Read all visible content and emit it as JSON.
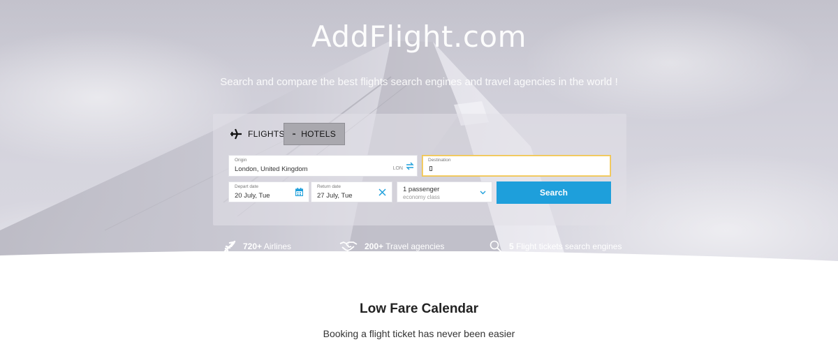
{
  "brand": "AddFlight.com",
  "tagline": "Search and compare the best flights search engines and travel agencies in the world !",
  "tabs": [
    {
      "label": "FLIGHTS",
      "icon": "airplane-icon",
      "active": false
    },
    {
      "label": "HOTELS",
      "icon": "bed-icon",
      "active": true
    }
  ],
  "origin": {
    "label": "Origin",
    "value": "London, United Kingdom",
    "code": "LON"
  },
  "destination": {
    "label": "Destination",
    "value": ""
  },
  "depart": {
    "label": "Depart date",
    "value": "20 July, Tue"
  },
  "return": {
    "label": "Return date",
    "value": "27 July, Tue"
  },
  "passengers": {
    "value": "1 passenger",
    "class": "economy class"
  },
  "search_button": "Search",
  "stats": [
    {
      "count": "720+",
      "label": "Airlines",
      "icon": "airplane-icon"
    },
    {
      "count": "200+",
      "label": "Travel agencies",
      "icon": "handshake-icon"
    },
    {
      "count": "5",
      "label": "Flight tickets search engines",
      "icon": "search-icon"
    }
  ],
  "section": {
    "title": "Low Fare Calendar",
    "subtitle": "Booking a flight ticket has never been easier"
  },
  "colors": {
    "accent": "#1e9fdb",
    "focus": "#f0c24a"
  }
}
